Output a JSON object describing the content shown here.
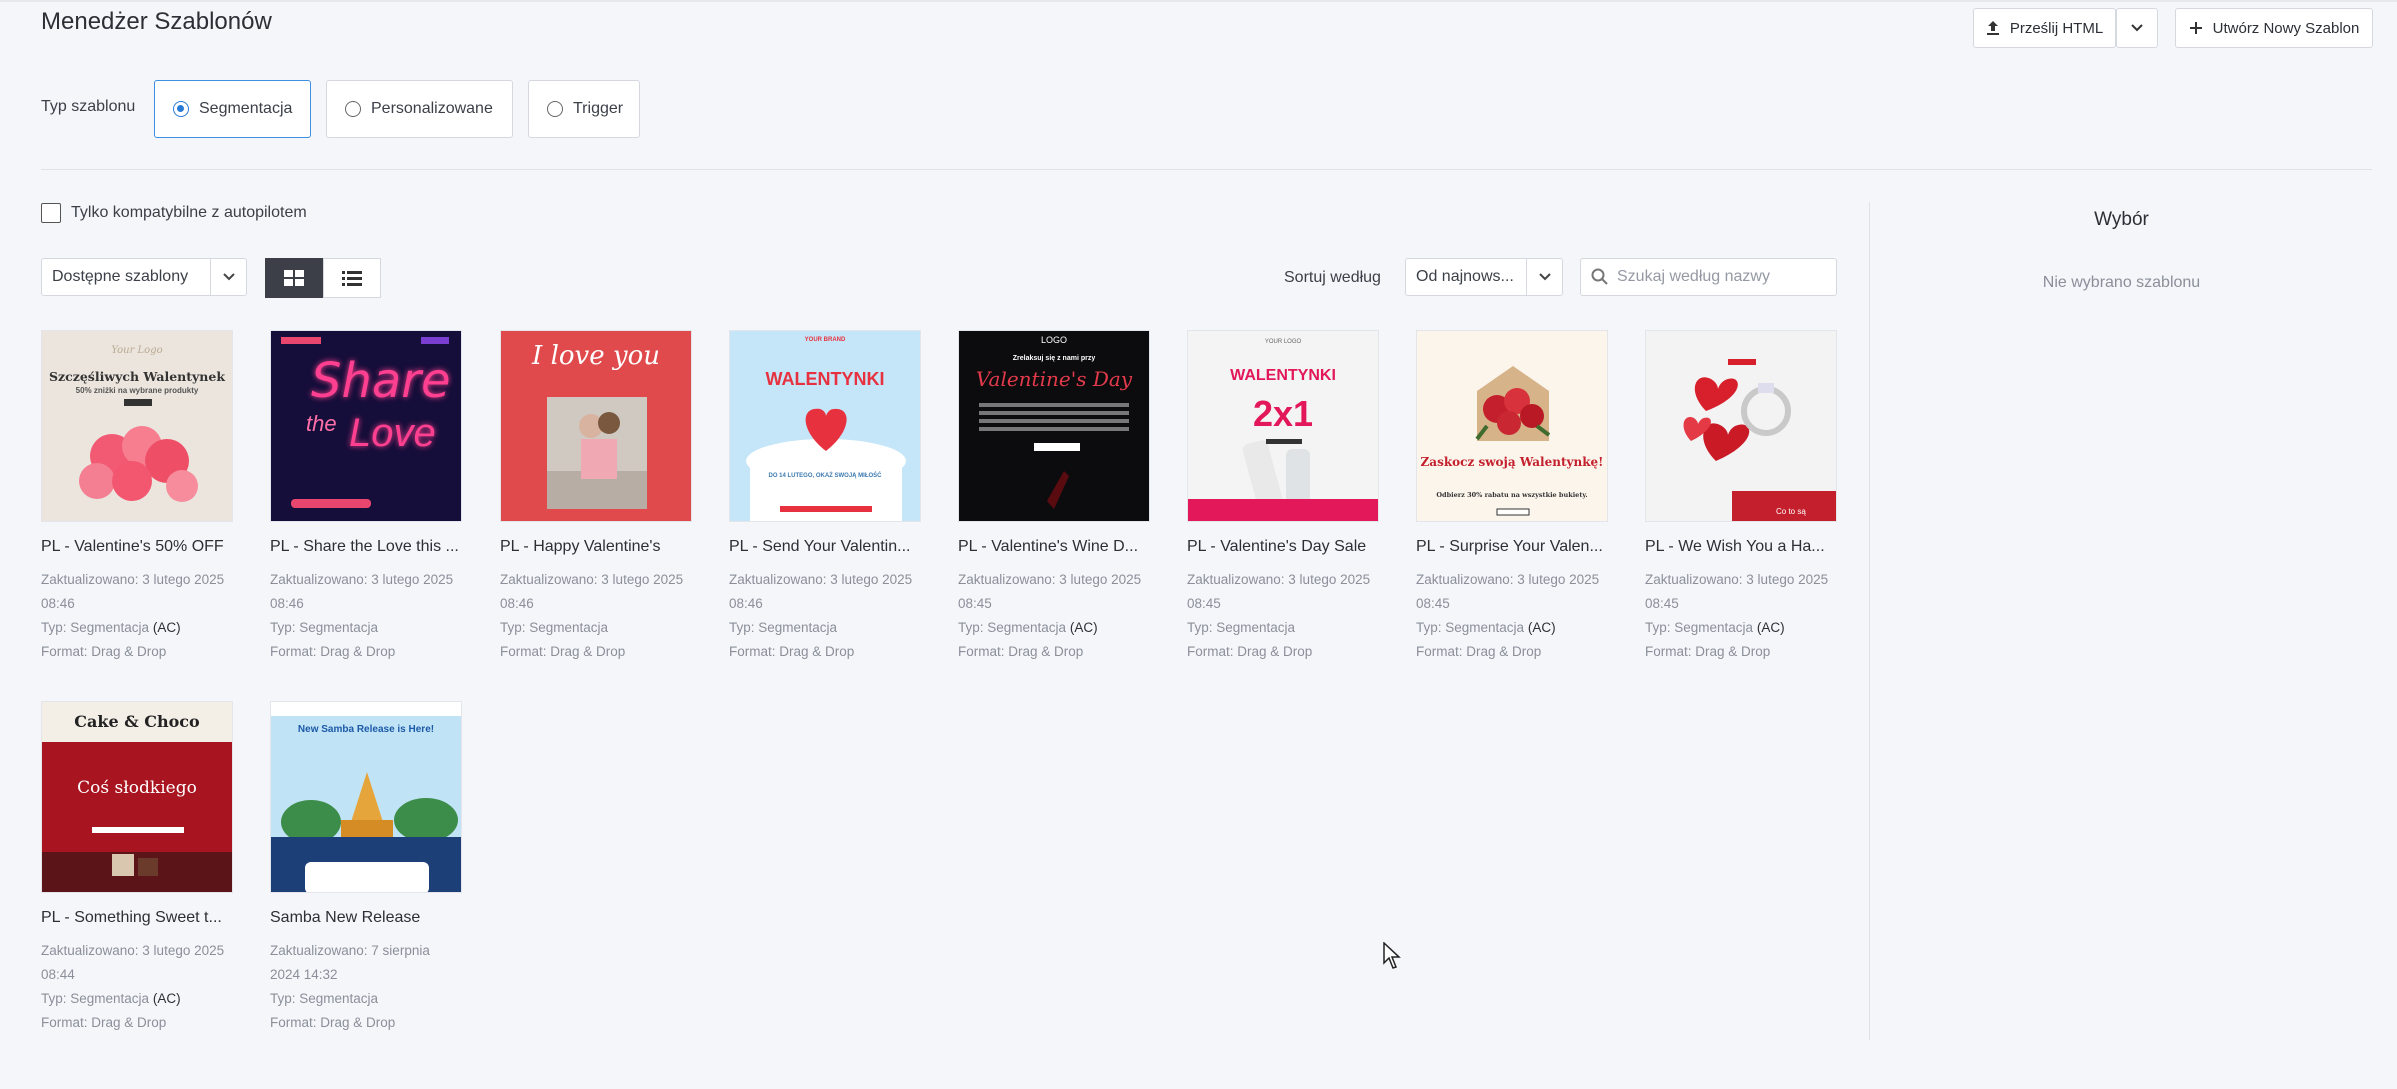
{
  "header": {
    "title": "Menedżer Szablonów",
    "upload_label": "Prześlij HTML",
    "create_label": "Utwórz Nowy Szablon"
  },
  "template_type": {
    "label": "Typ szablonu",
    "options": [
      "Segmentacja",
      "Personalizowane",
      "Trigger"
    ],
    "selected": "Segmentacja"
  },
  "filters": {
    "autopilot_label": "Tylko kompatybilne z autopilotem",
    "source_value": "Dostępne szablony",
    "sort_label": "Sortuj według",
    "sort_value": "Od najnows...",
    "search_placeholder": "Szukaj według nazwy"
  },
  "panel": {
    "title": "Wybór",
    "empty_text": "Nie wybrano szablonu"
  },
  "templates": [
    {
      "name": "PL - Valentine's 50% OFF",
      "updated1": "Zaktualizowano: 3 lutego 2025",
      "updated2": "08:46",
      "type": "Typ: Segmentacja",
      "ac": "(AC)",
      "format": "Format: Drag & Drop",
      "thumb_title": "Szczęśliwych Walentynek",
      "thumb_sub": "50% zniżki na wybrane produkty",
      "thumb_logo": "Your Logo"
    },
    {
      "name": "PL - Share the Love this ...",
      "updated1": "Zaktualizowano: 3 lutego 2025",
      "updated2": "08:46",
      "type": "Typ: Segmentacja",
      "ac": "",
      "format": "Format: Drag & Drop",
      "thumb_title": "Share",
      "thumb_sub": "the",
      "thumb_logo": "Love"
    },
    {
      "name": "PL - Happy Valentine's",
      "updated1": "Zaktualizowano: 3 lutego 2025",
      "updated2": "08:46",
      "type": "Typ: Segmentacja",
      "ac": "",
      "format": "Format: Drag & Drop",
      "thumb_title": "I love you",
      "thumb_sub": "",
      "thumb_logo": ""
    },
    {
      "name": "PL - Send Your Valentin...",
      "updated1": "Zaktualizowano: 3 lutego 2025",
      "updated2": "08:46",
      "type": "Typ: Segmentacja",
      "ac": "",
      "format": "Format: Drag & Drop",
      "thumb_title": "WALENTYNKI",
      "thumb_sub": "DO 14 LUTEGO, OKAŻ SWOJĄ MIŁOŚĆ",
      "thumb_logo": "YOUR BRAND"
    },
    {
      "name": "PL - Valentine's Wine D...",
      "updated1": "Zaktualizowano: 3 lutego 2025",
      "updated2": "08:45",
      "type": "Typ: Segmentacja",
      "ac": "(AC)",
      "format": "Format: Drag & Drop",
      "thumb_title": "Valentine's Day",
      "thumb_sub": "Zrelaksuj się z nami przy",
      "thumb_logo": "LOGO"
    },
    {
      "name": "PL - Valentine's Day Sale",
      "updated1": "Zaktualizowano: 3 lutego 2025",
      "updated2": "08:45",
      "type": "Typ: Segmentacja",
      "ac": "",
      "format": "Format: Drag & Drop",
      "thumb_title": "WALENTYNKI",
      "thumb_sub": "2x1",
      "thumb_logo": "YOUR LOGO"
    },
    {
      "name": "PL - Surprise Your Valen...",
      "updated1": "Zaktualizowano: 3 lutego 2025",
      "updated2": "08:45",
      "type": "Typ: Segmentacja",
      "ac": "(AC)",
      "format": "Format: Drag & Drop",
      "thumb_title": "Zaskocz swoją Walentynkę!",
      "thumb_sub": "Odbierz 30% rabatu na wszystkie bukiety.",
      "thumb_logo": ""
    },
    {
      "name": "PL - We Wish You a Ha...",
      "updated1": "Zaktualizowano: 3 lutego 2025",
      "updated2": "08:45",
      "type": "Typ: Segmentacja",
      "ac": "(AC)",
      "format": "Format: Drag & Drop",
      "thumb_title": "Co to są",
      "thumb_sub": "",
      "thumb_logo": ""
    },
    {
      "name": "PL - Something Sweet t...",
      "updated1": "Zaktualizowano: 3 lutego 2025",
      "updated2": "08:44",
      "type": "Typ: Segmentacja",
      "ac": "(AC)",
      "format": "Format: Drag & Drop",
      "thumb_title": "Coś słodkiego",
      "thumb_sub": "Cake & Choco",
      "thumb_logo": ""
    },
    {
      "name": "Samba New Release",
      "updated1": "Zaktualizowano: 7 sierpnia",
      "updated2": "2024 14:32",
      "type": "Typ: Segmentacja",
      "ac": "",
      "format": "Format: Drag & Drop",
      "thumb_title": "New Samba Release is Here!",
      "thumb_sub": "",
      "thumb_logo": ""
    }
  ]
}
